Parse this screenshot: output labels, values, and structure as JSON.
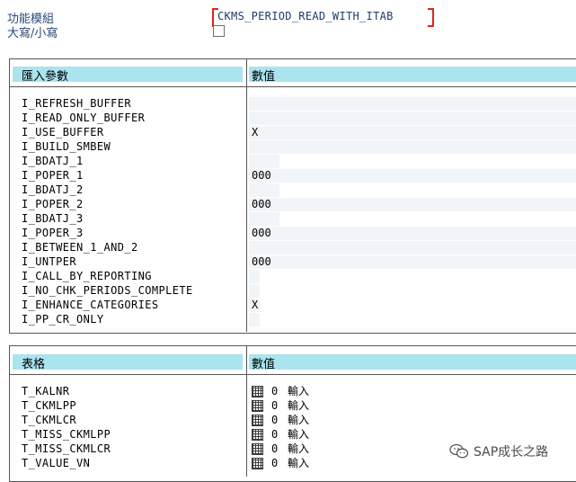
{
  "header": {
    "function_module_label": "功能模組",
    "function_module_value": "CKMS_PERIOD_READ_WITH_ITAB",
    "uppercase_label": "大寫/小寫",
    "uppercase_checked": false
  },
  "import_section": {
    "col_param": "匯入參數",
    "col_value": "數值",
    "rows": [
      {
        "name": "I_REFRESH_BUFFER",
        "value": ""
      },
      {
        "name": "I_READ_ONLY_BUFFER",
        "value": ""
      },
      {
        "name": "I_USE_BUFFER",
        "value": "X"
      },
      {
        "name": "I_BUILD_SMBEW",
        "value": ""
      },
      {
        "name": "I_BDATJ_1",
        "value": ""
      },
      {
        "name": "I_POPER_1",
        "value": "000"
      },
      {
        "name": "I_BDATJ_2",
        "value": ""
      },
      {
        "name": "I_POPER_2",
        "value": "000"
      },
      {
        "name": "I_BDATJ_3",
        "value": ""
      },
      {
        "name": "I_POPER_3",
        "value": "000"
      },
      {
        "name": "I_BETWEEN_1_AND_2",
        "value": ""
      },
      {
        "name": "I_UNTPER",
        "value": "000"
      },
      {
        "name": "I_CALL_BY_REPORTING",
        "value": ""
      },
      {
        "name": "I_NO_CHK_PERIODS_COMPLETE",
        "value": ""
      },
      {
        "name": "I_ENHANCE_CATEGORIES",
        "value": "X"
      },
      {
        "name": "I_PP_CR_ONLY",
        "value": ""
      }
    ]
  },
  "tables_section": {
    "col_table": "表格",
    "col_value": "數值",
    "rows": [
      {
        "name": "T_KALNR",
        "count": "0",
        "type": "輸入"
      },
      {
        "name": "T_CKMLPP",
        "count": "0",
        "type": "輸入"
      },
      {
        "name": "T_CKMLCR",
        "count": "0",
        "type": "輸入"
      },
      {
        "name": "T_MISS_CKMLPP",
        "count": "0",
        "type": "輸入"
      },
      {
        "name": "T_MISS_CKMLCR",
        "count": "0",
        "type": "輸入"
      },
      {
        "name": "T_VALUE_VN",
        "count": "0",
        "type": "輸入"
      }
    ]
  },
  "watermark": {
    "icon": "wechat-icon",
    "text": "SAP成长之路"
  }
}
